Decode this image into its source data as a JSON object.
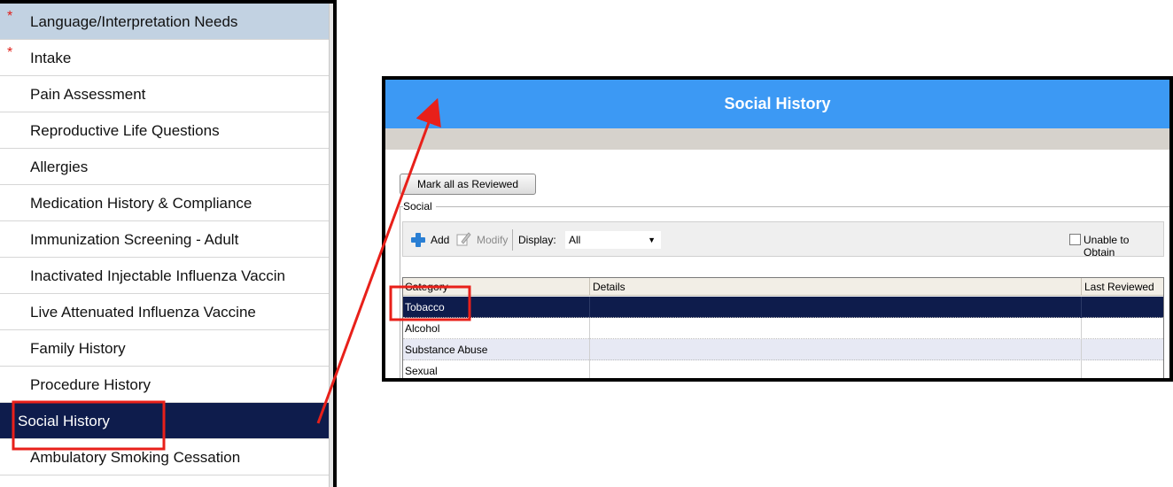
{
  "nav": {
    "items": [
      {
        "label": "Language/Interpretation Needs",
        "required": true
      },
      {
        "label": "Intake",
        "required": true
      },
      {
        "label": "Pain Assessment"
      },
      {
        "label": "Reproductive Life Questions"
      },
      {
        "label": "Allergies"
      },
      {
        "label": "Medication History & Compliance"
      },
      {
        "label": "Immunization Screening - Adult"
      },
      {
        "label": "Inactivated Injectable Influenza Vaccin"
      },
      {
        "label": "Live Attenuated Influenza Vaccine"
      },
      {
        "label": "Family History"
      },
      {
        "label": "Procedure History"
      },
      {
        "label": "Social History",
        "selected": true
      },
      {
        "label": "Ambulatory Smoking Cessation"
      }
    ],
    "required_marker": "*"
  },
  "window": {
    "title": "Social History",
    "mark_reviewed_label": "Mark all as Reviewed",
    "group_label": "Social",
    "toolbar": {
      "add_label": "Add",
      "modify_label": "Modify",
      "display_label": "Display:",
      "display_value": "All",
      "unable_label": "Unable to Obtain"
    },
    "grid": {
      "columns": [
        "Category",
        "Details",
        "Last Reviewed"
      ],
      "rows": [
        {
          "category": "Tobacco",
          "details": "",
          "last_reviewed": "",
          "selected": true
        },
        {
          "category": "Alcohol",
          "details": "",
          "last_reviewed": ""
        },
        {
          "category": "Substance Abuse",
          "details": "",
          "last_reviewed": ""
        },
        {
          "category": "Sexual",
          "details": "",
          "last_reviewed": ""
        }
      ]
    }
  },
  "colors": {
    "title_bar": "#3c99f4",
    "selection": "#0e1c4c",
    "annotation": "#e8201a"
  }
}
